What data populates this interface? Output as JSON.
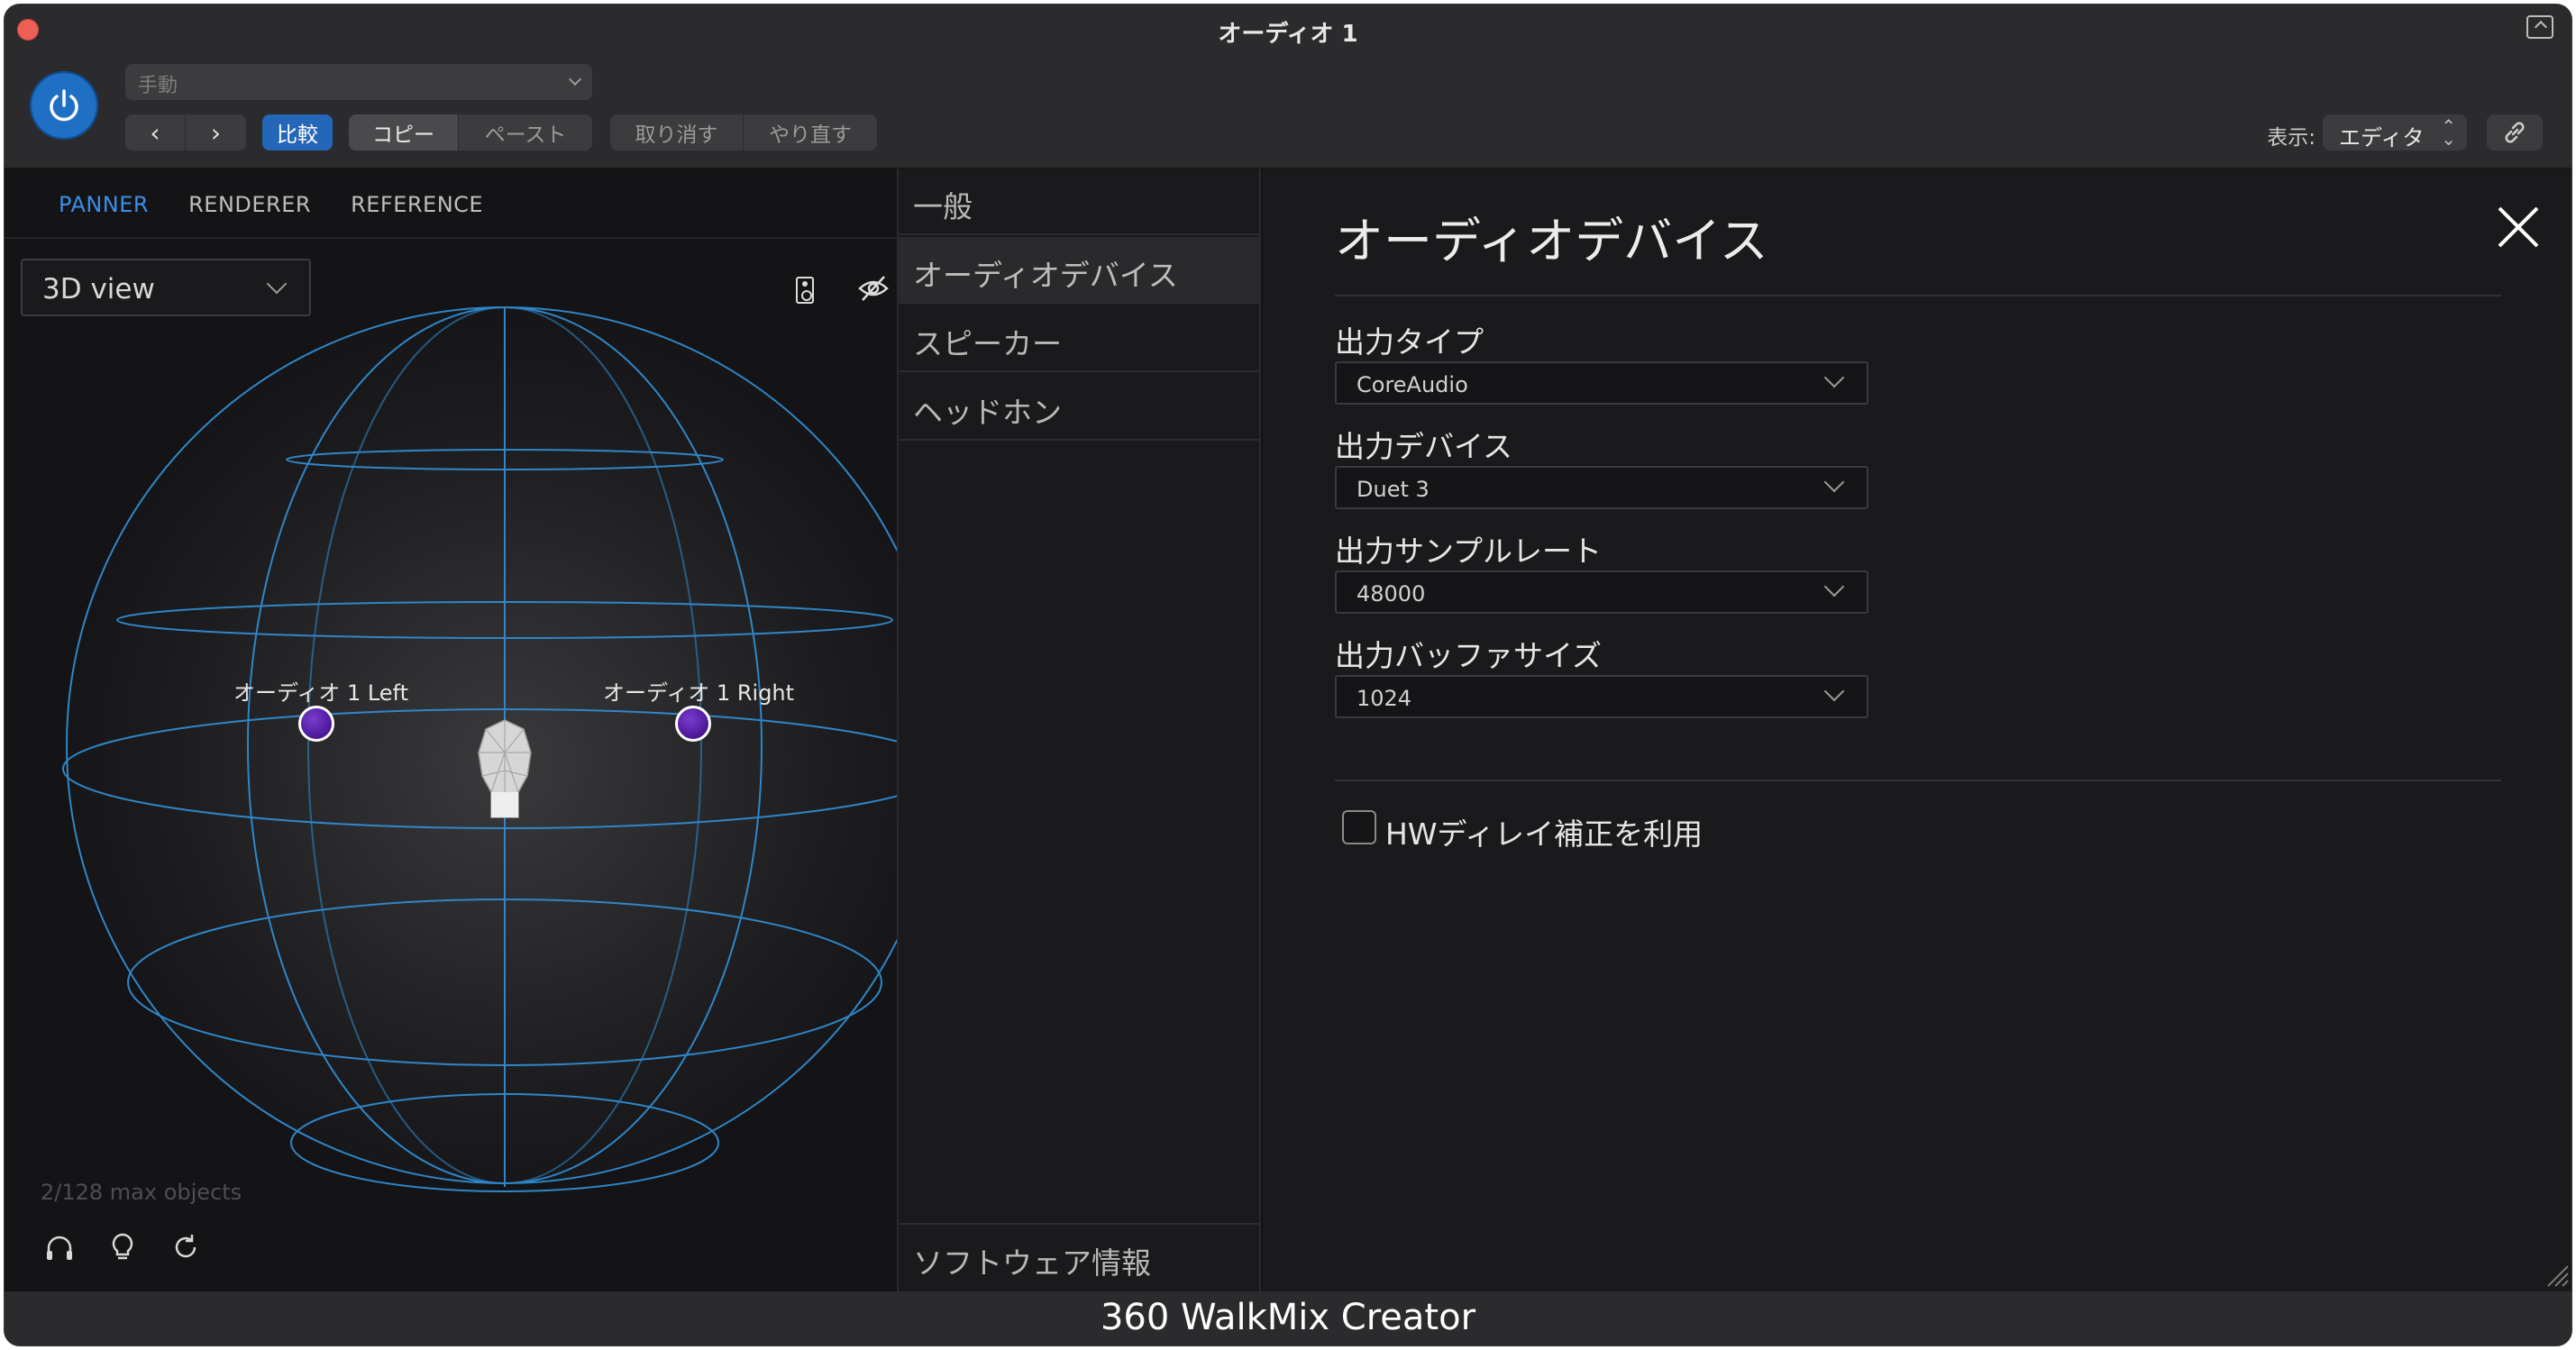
{
  "window": {
    "title": "オーディオ 1"
  },
  "host_toolbar": {
    "preset_placeholder": "手動",
    "compare_label": "比較",
    "copy_label": "コピー",
    "paste_label": "ペースト",
    "undo_label": "取り消す",
    "redo_label": "やり直す",
    "display_label": "表示:",
    "display_value": "エディタ",
    "nav_back": "‹",
    "nav_forward": "›",
    "accent_color": "#2466b8"
  },
  "panner": {
    "tabs": [
      {
        "label": "PANNER",
        "active": true
      },
      {
        "label": "RENDERER",
        "active": false
      },
      {
        "label": "REFERENCE",
        "active": false
      }
    ],
    "view_select": "3D view",
    "objects": [
      {
        "label": "オーディオ 1 Left"
      },
      {
        "label": "オーディオ 1 Right"
      }
    ],
    "object_count": "2/128 max objects",
    "bottom_icons": [
      "headphones-icon",
      "lightbulb-icon",
      "refresh-icon"
    ]
  },
  "menu": {
    "items": [
      {
        "label": "一般"
      },
      {
        "label": "オーディオデバイス",
        "active": true
      },
      {
        "label": "スピーカー"
      },
      {
        "label": "ヘッドホン"
      }
    ],
    "bottom_item": "ソフトウェア情報"
  },
  "settings": {
    "title": "オーディオデバイス",
    "fields": [
      {
        "label": "出力タイプ",
        "value": "CoreAudio"
      },
      {
        "label": "出力デバイス",
        "value": "Duet 3"
      },
      {
        "label": "出力サンプルレート",
        "value": "48000"
      },
      {
        "label": "出力バッファサイズ",
        "value": "1024"
      }
    ],
    "hw_delay_label": "HWディレイ補正を利用",
    "hw_delay_checked": false
  },
  "footer": {
    "label": "360 WalkMix Creator"
  }
}
